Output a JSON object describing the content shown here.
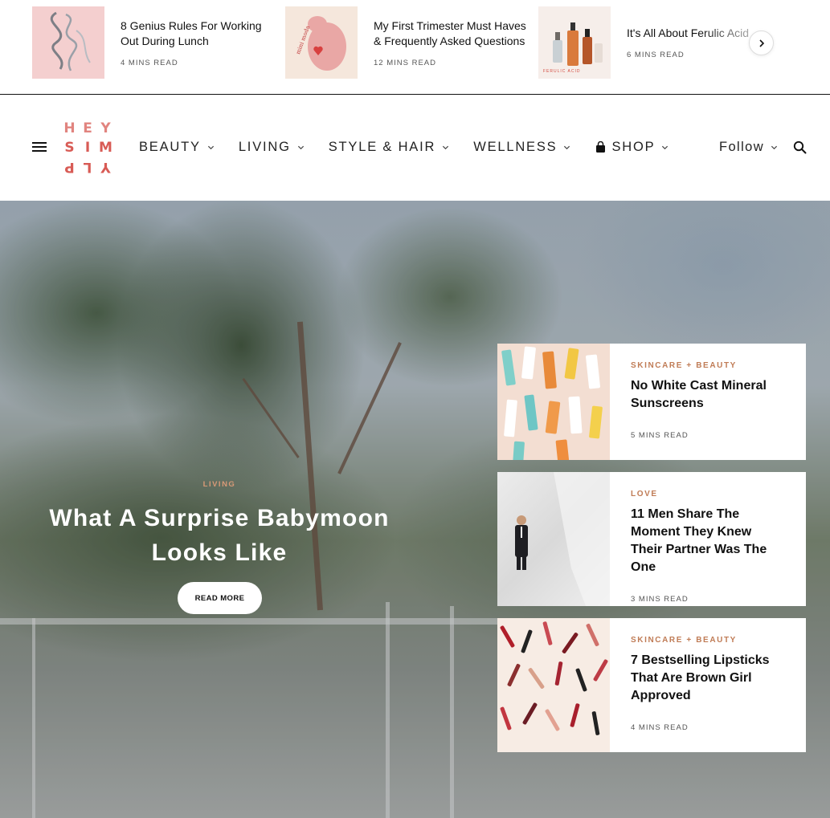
{
  "trending": {
    "items": [
      {
        "title": "8 Genius Rules For Working Out During Lunch",
        "meta": "4 MINS READ",
        "thumb": "pink-ribbon-image"
      },
      {
        "title": "My First Trimester Must Haves & Frequently Asked Questions",
        "meta": "12 MINS READ",
        "thumb": "pregnant-illustration-image",
        "thumb_text": "mini moda"
      },
      {
        "title": "It's All About Ferulic Acid",
        "meta": "6 MINS READ",
        "thumb": "serum-bottles-image",
        "thumb_text": "FERULIC ACID"
      }
    ],
    "next_icon": "chevron-right-icon"
  },
  "header": {
    "logo": {
      "row1": [
        "H",
        "E",
        "Y"
      ],
      "row2": [
        "S",
        "I",
        "M"
      ],
      "row3": [
        "P",
        "L",
        "Y"
      ],
      "color": "#d85b55"
    },
    "menu_icon": "hamburger-icon",
    "nav": [
      {
        "label": "BEAUTY"
      },
      {
        "label": "LIVING"
      },
      {
        "label": "STYLE & HAIR"
      },
      {
        "label": "WELLNESS"
      },
      {
        "label": "SHOP",
        "icon": "shopping-bag-icon"
      }
    ],
    "follow_label": "Follow",
    "search_icon": "search-icon"
  },
  "hero": {
    "category": "LIVING",
    "title": "What A Surprise Babymoon Looks Like",
    "button_label": "READ MORE",
    "category_color": "#d89a77"
  },
  "cards": [
    {
      "category": "SKINCARE + BEAUTY",
      "title": "No White Cast Mineral Sunscreens",
      "meta": "5 MINS READ",
      "image": "sunscreen-tubes-image"
    },
    {
      "category": "LOVE",
      "title": "11 Men Share The Moment They Knew Their Partner Was The One",
      "meta": "3 MINS READ",
      "image": "groom-figurine-image"
    },
    {
      "category": "SKINCARE + BEAUTY",
      "title": "7 Bestselling Lipsticks That Are Brown Girl Approved",
      "meta": "4 MINS READ",
      "image": "lipsticks-pattern-image"
    }
  ],
  "colors": {
    "accent": "#c07c56",
    "logo": "#d85b55",
    "text": "#111111"
  }
}
